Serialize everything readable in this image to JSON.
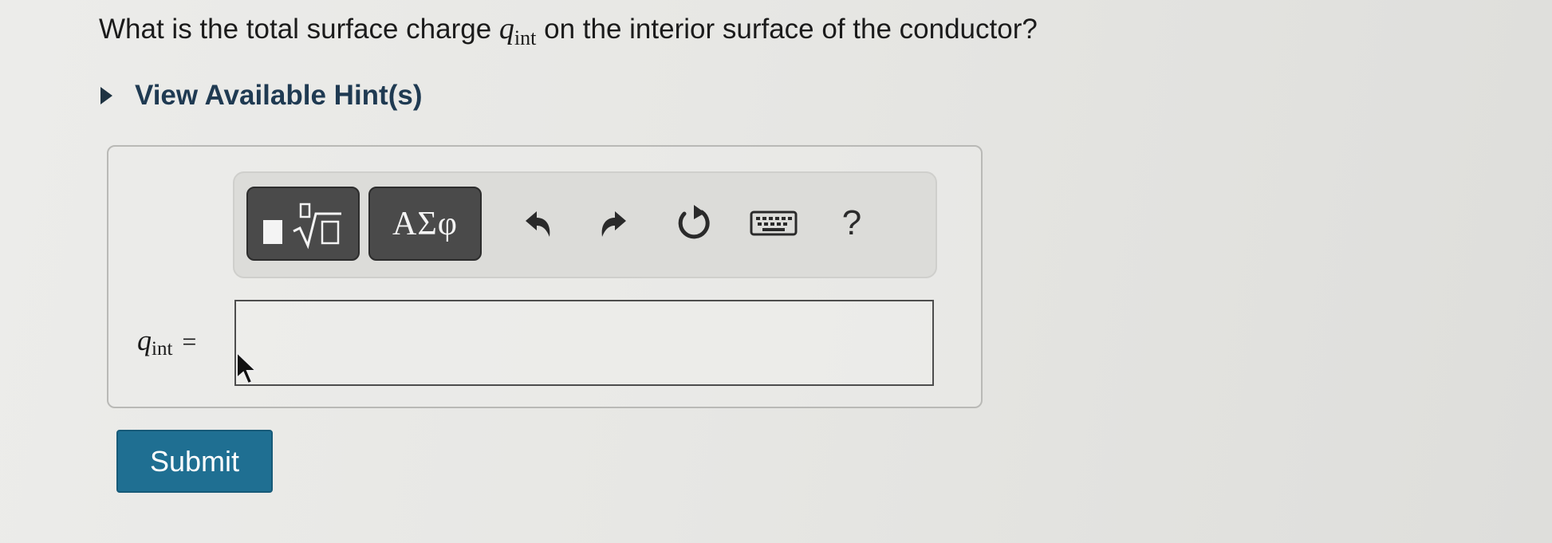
{
  "question": {
    "text_before": "What is the total surface charge",
    "var": "q",
    "sub": "int",
    "text_after": "on the interior surface of the conductor?"
  },
  "hints": {
    "label": "View Available Hint(s)"
  },
  "toolbar": {
    "greek_label": "ΑΣφ",
    "help_label": "?",
    "icons": [
      "templates-icon",
      "undo-icon",
      "redo-icon",
      "reset-icon",
      "keyboard-icon"
    ]
  },
  "answer": {
    "var": "q",
    "sub": "int",
    "equals": "=",
    "value": ""
  },
  "submit": {
    "label": "Submit"
  },
  "colors": {
    "submit_bg": "#1f6f92",
    "hint_text": "#1f3a52",
    "tool_btn_dark": "#4a4a4a"
  }
}
